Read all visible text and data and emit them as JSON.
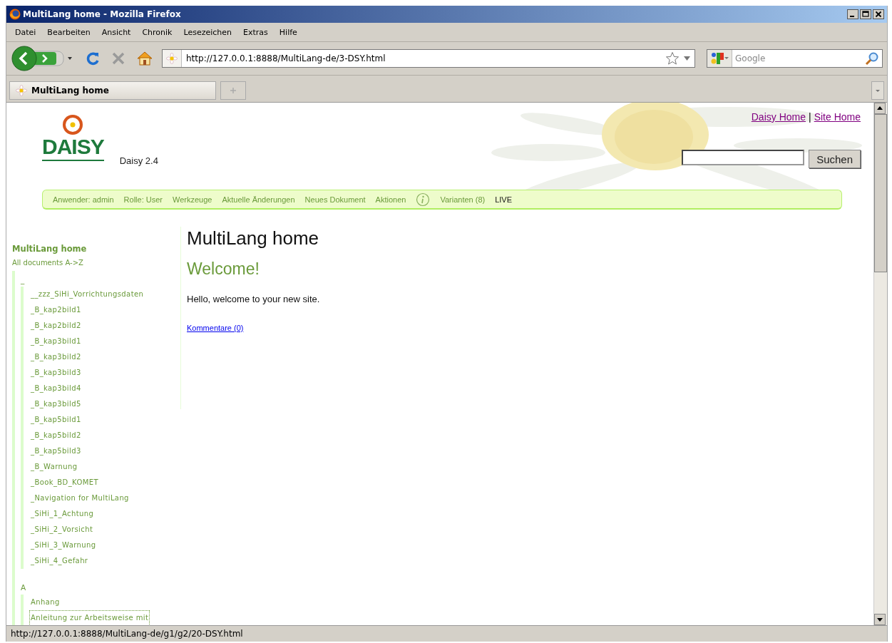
{
  "window": {
    "title": "MultiLang home - Mozilla Firefox"
  },
  "menu": [
    "Datei",
    "Bearbeiten",
    "Ansicht",
    "Chronik",
    "Lesezeichen",
    "Extras",
    "Hilfe"
  ],
  "toolbar": {
    "url": "http://127.0.0.1:8888/MultiLang-de/3-DSY.html",
    "search_placeholder": "Google"
  },
  "tabs": [
    {
      "label": "MultiLang home",
      "selected": true
    }
  ],
  "page": {
    "brand": "DAISY",
    "version": "Daisy 2.4",
    "top_links": [
      {
        "label": "Daisy Home",
        "visited": true
      },
      {
        "label": "Site Home",
        "visited": true
      }
    ],
    "top_links_separator": "|",
    "search": {
      "button": "Suchen"
    },
    "navbar": [
      {
        "label": "Anwender: admin",
        "kind": "text"
      },
      {
        "label": "Rolle: User",
        "kind": "text"
      },
      {
        "label": "Werkzeuge",
        "kind": "link"
      },
      {
        "label": "Aktuelle Änderungen",
        "kind": "link"
      },
      {
        "label": "Neues Dokument",
        "kind": "link"
      },
      {
        "label": "Aktionen",
        "kind": "link"
      },
      {
        "kind": "info"
      },
      {
        "label": "Varianten (8)",
        "kind": "link"
      },
      {
        "label": "LIVE",
        "kind": "mode"
      }
    ],
    "sidebar": {
      "title": "MultiLang home",
      "subtitle": "All documents A->Z",
      "tree": [
        {
          "label": "_",
          "children": [
            {
              "label": "__zzz_SiHi_Vorrichtungsdaten",
              "focused": false
            },
            {
              "label": "_B_kap2bild1",
              "focused": false
            },
            {
              "label": "_B_kap2bild2",
              "focused": false
            },
            {
              "label": "_B_kap3bild1",
              "focused": false
            },
            {
              "label": "_B_kap3bild2",
              "focused": false
            },
            {
              "label": "_B_kap3bild3",
              "focused": false
            },
            {
              "label": "_B_kap3bild4",
              "focused": false
            },
            {
              "label": "_B_kap3bild5",
              "focused": false
            },
            {
              "label": "_B_kap5bild1",
              "focused": false
            },
            {
              "label": "_B_kap5bild2",
              "focused": false
            },
            {
              "label": "_B_kap5bild3",
              "focused": false
            },
            {
              "label": "_B_Warnung",
              "focused": false
            },
            {
              "label": "_Book_BD_KOMET",
              "focused": false
            },
            {
              "label": "_Navigation for MultiLang",
              "focused": false
            },
            {
              "label": "_SiHi_1_Achtung",
              "focused": false
            },
            {
              "label": "_SiHi_2_Vorsicht",
              "focused": false
            },
            {
              "label": "_SiHi_3_Warnung",
              "focused": false
            },
            {
              "label": "_SiHi_4_Gefahr",
              "focused": false
            }
          ]
        },
        {
          "label": "A",
          "children": [
            {
              "label": "Anhang",
              "focused": false
            },
            {
              "label": "Anleitung zur Arbeitsweise mit",
              "focused": true
            }
          ]
        }
      ]
    },
    "heading": "MultiLang home",
    "subheading": "Welcome!",
    "paragraph": "Hello, welcome to your new site.",
    "comments_link": "Kommentare (0)"
  },
  "status_bar": "http://127.0.0.1:8888/MultiLang-de/g1/g2/20-DSY.html"
}
